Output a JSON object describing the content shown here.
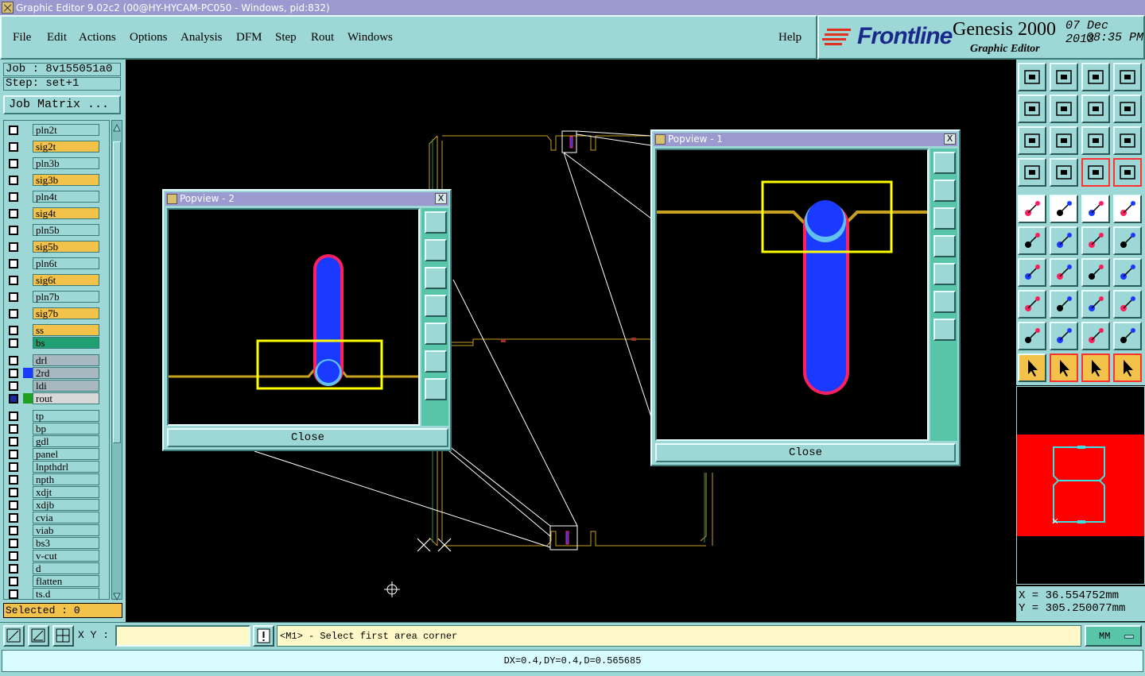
{
  "window": {
    "title": "Graphic Editor 9.02c2 (00@HY-HYCAM-PC050 - Windows, pid:832)"
  },
  "menu": [
    {
      "label": "File"
    },
    {
      "label": "Edit"
    },
    {
      "label": "Actions"
    },
    {
      "label": "Options"
    },
    {
      "label": "Analysis"
    },
    {
      "label": "DFM"
    },
    {
      "label": "Step"
    },
    {
      "label": "Rout"
    },
    {
      "label": "Windows"
    },
    {
      "label": "Help"
    }
  ],
  "brand": {
    "logo": "Frontline",
    "product": "Genesis 2000",
    "subtitle": "Graphic Editor",
    "date": "07 Dec 2013",
    "time": "08:35 PM"
  },
  "job": {
    "job_label": "Job : 8v155051a0",
    "step_label": "Step: set+1",
    "job_matrix": "Job Matrix ..."
  },
  "layers": [
    {
      "name": "pln2t",
      "color": "#9ed8d6"
    },
    {
      "name": "sig2t",
      "color": "#f2c24a"
    },
    {
      "name": "pln3b",
      "color": "#9ed8d6"
    },
    {
      "name": "sig3b",
      "color": "#f2c24a"
    },
    {
      "name": "pln4t",
      "color": "#9ed8d6"
    },
    {
      "name": "sig4t",
      "color": "#f2c24a"
    },
    {
      "name": "pln5b",
      "color": "#9ed8d6"
    },
    {
      "name": "sig5b",
      "color": "#f2c24a"
    },
    {
      "name": "pln6t",
      "color": "#9ed8d6"
    },
    {
      "name": "sig6t",
      "color": "#f2c24a"
    },
    {
      "name": "pln7b",
      "color": "#9ed8d6"
    },
    {
      "name": "sig7b",
      "color": "#f2c24a"
    },
    {
      "name": "ss",
      "color": "#f2c24a"
    },
    {
      "name": "bs",
      "color": "#20a070"
    },
    {
      "name": "drl",
      "color": "#a8b8c0"
    },
    {
      "name": "2rd",
      "color": "#a8b8c0"
    },
    {
      "name": "ldi",
      "color": "#a8b8c0"
    },
    {
      "name": "rout",
      "color": "#d8d8d8"
    },
    {
      "name": "tp",
      "color": "#9ed8d6"
    },
    {
      "name": "bp",
      "color": "#9ed8d6"
    },
    {
      "name": "gdl",
      "color": "#9ed8d6"
    },
    {
      "name": "panel",
      "color": "#9ed8d6"
    },
    {
      "name": "lnpthdrl",
      "color": "#9ed8d6"
    },
    {
      "name": "npth",
      "color": "#9ed8d6"
    },
    {
      "name": "xdjt",
      "color": "#9ed8d6"
    },
    {
      "name": "xdjb",
      "color": "#9ed8d6"
    },
    {
      "name": "cvia",
      "color": "#9ed8d6"
    },
    {
      "name": "viab",
      "color": "#9ed8d6"
    },
    {
      "name": "bs3",
      "color": "#9ed8d6"
    },
    {
      "name": "v-cut",
      "color": "#9ed8d6"
    },
    {
      "name": "d",
      "color": "#9ed8d6"
    },
    {
      "name": "flatten",
      "color": "#9ed8d6"
    },
    {
      "name": "ts.d",
      "color": "#9ed8d6"
    }
  ],
  "selected_label": "Selected : 0",
  "popview2": {
    "title": "Popview - 2",
    "close": "Close",
    "x_label": "X"
  },
  "popview1": {
    "title": "Popview - 1",
    "close": "Close",
    "x_label": "X"
  },
  "coords": {
    "x": "X  =  36.554752mm",
    "y": "Y  = 305.250077mm"
  },
  "bottom": {
    "xy_label": "X Y :",
    "xy_value": "",
    "prompt": "<M1> - Select first area corner",
    "units": "MM",
    "status": "DX=0.4,DY=0.4,D=0.565685"
  },
  "colors": {
    "panel": "#9ed8d6",
    "titlebar": "#9a9ad0",
    "signal_trace": "#c8a020",
    "pad_blue": "#1a3aff",
    "pad_outline": "#ff2060",
    "highlight_box": "#ffff00",
    "minimap_bg": "#ff0000",
    "minimap_outline": "#40e0e0"
  }
}
